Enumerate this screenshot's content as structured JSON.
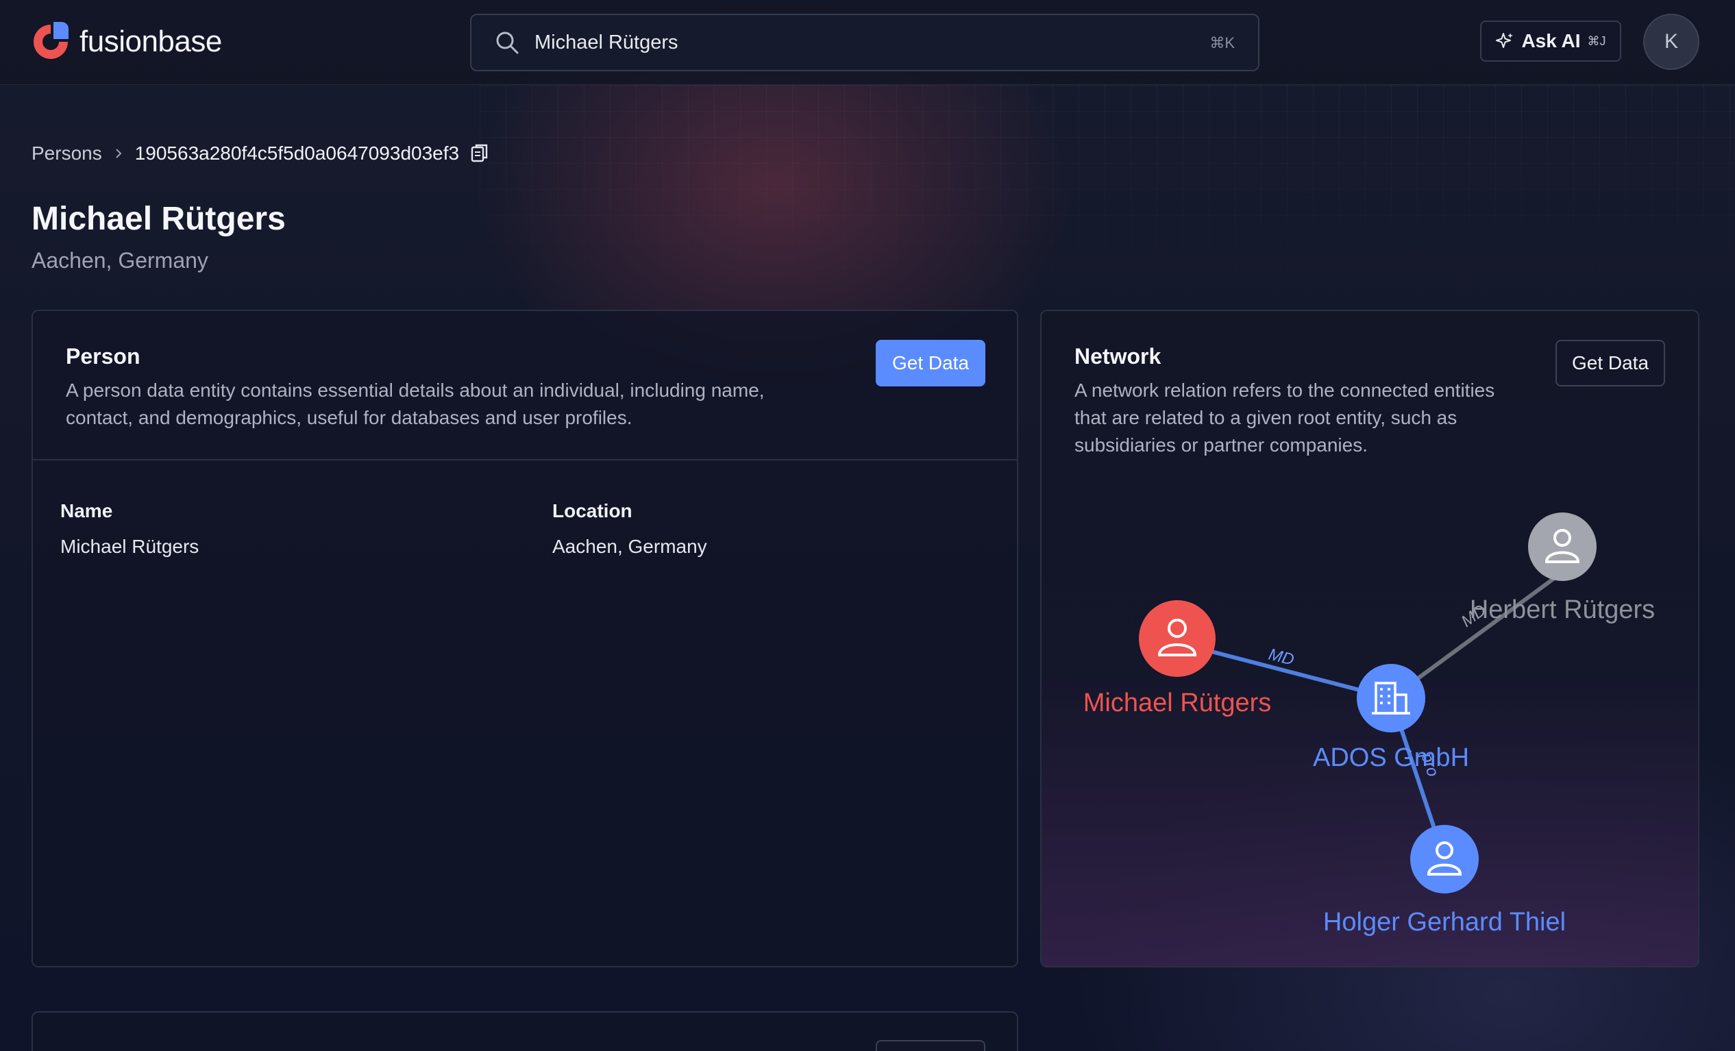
{
  "brand": {
    "name": "fusionbase"
  },
  "search": {
    "value": "Michael Rütgers",
    "shortcut": "⌘K"
  },
  "ask_ai": {
    "label": "Ask AI",
    "shortcut": "⌘J"
  },
  "user": {
    "initial": "K"
  },
  "breadcrumb": {
    "root": "Persons",
    "current": "190563a280f4c5f5d0a0647093d03ef3"
  },
  "entity": {
    "name": "Michael Rütgers",
    "location": "Aachen, Germany"
  },
  "person_card": {
    "title": "Person",
    "description_line1": "A person data entity contains essential details about an individual, including name,",
    "description_line2": "contact, and demographics, useful for databases and user profiles.",
    "button": "Get Data",
    "fields": [
      {
        "label": "Name",
        "value": "Michael Rütgers"
      },
      {
        "label": "Location",
        "value": "Aachen, Germany"
      }
    ]
  },
  "network_card": {
    "title": "Network",
    "description_line1": "A network relation refers to the connected entities",
    "description_line2": "that are related to a given root entity, such as",
    "description_line3": "subsidiaries or partner companies.",
    "button": "Get Data",
    "nodes": [
      {
        "id": "michael",
        "label": "Michael Rütgers",
        "kind": "person-root",
        "color": "#ef5350"
      },
      {
        "id": "ados",
        "label": "ADOS GmbH",
        "kind": "company",
        "color": "#5b8cff"
      },
      {
        "id": "herbert",
        "label": "Herbert Rütgers",
        "kind": "person",
        "color": "#9a9ea8"
      },
      {
        "id": "holger",
        "label": "Holger Gerhard Thiel",
        "kind": "person",
        "color": "#5b8cff"
      }
    ],
    "edges": [
      {
        "from": "michael",
        "to": "ados",
        "label": "MD"
      },
      {
        "from": "herbert",
        "to": "ados",
        "label": "MD"
      },
      {
        "from": "ados",
        "to": "holger",
        "label": "pro"
      }
    ]
  },
  "colors": {
    "accent": "#5b8cff",
    "root_node": "#ef5350",
    "inactive_node": "#9a9ea8",
    "background": "#121628"
  }
}
